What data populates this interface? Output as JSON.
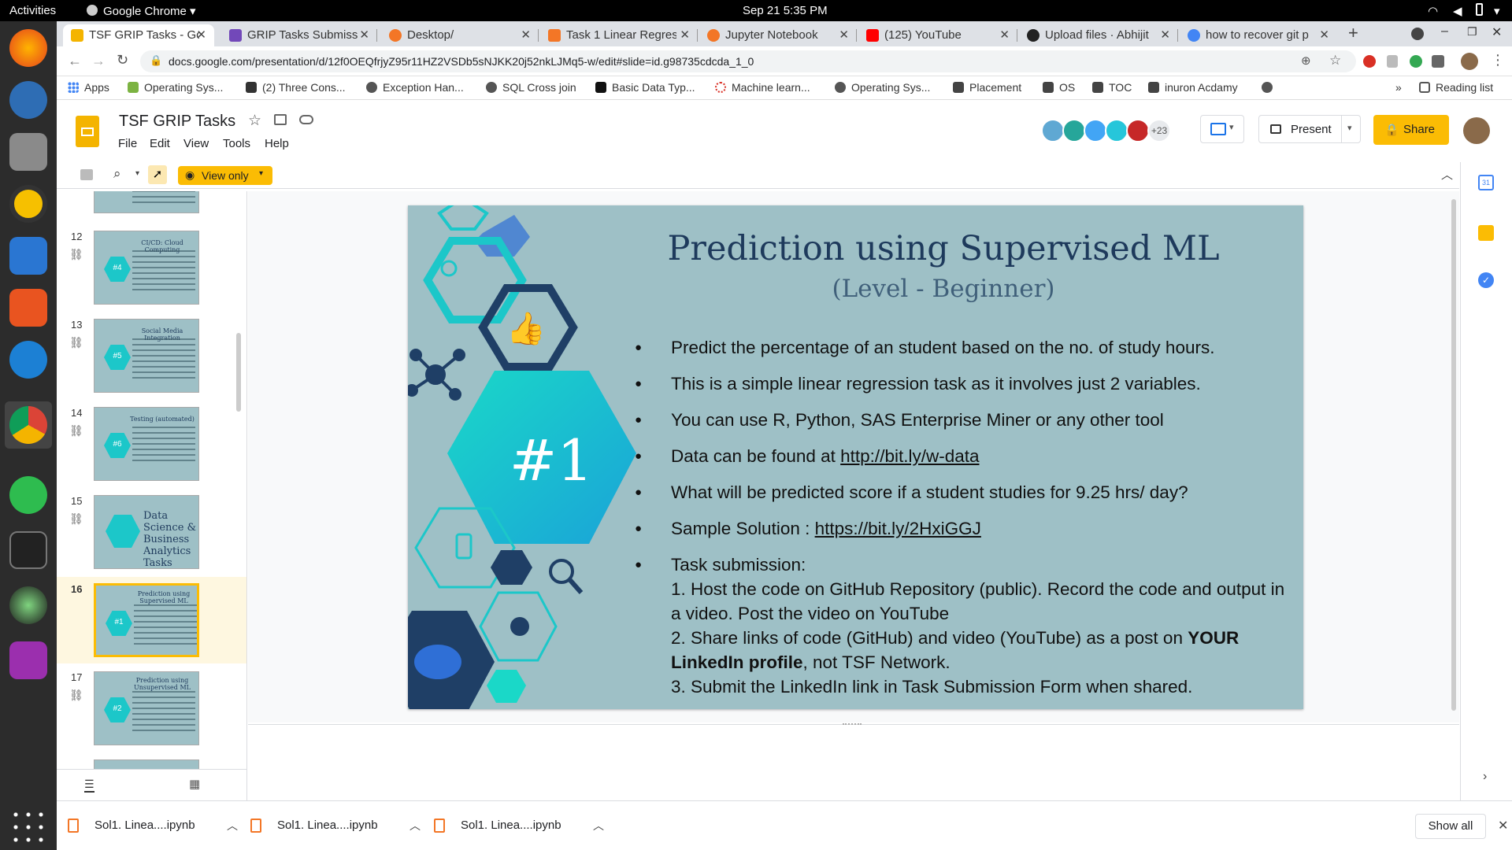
{
  "system": {
    "activities": "Activities",
    "app_menu": "Google Chrome",
    "clock": "Sep 21  5:35 PM"
  },
  "tabs": [
    {
      "label": "TSF GRIP Tasks - Goo",
      "color": "#f4b400"
    },
    {
      "label": "GRIP Tasks Submissi",
      "color": "#7248b9"
    },
    {
      "label": "Desktop/",
      "color": "#f37626"
    },
    {
      "label": "Task 1 Linear Regres",
      "color": "#f37626"
    },
    {
      "label": "Jupyter Notebook",
      "color": "#f37626"
    },
    {
      "label": "(125) YouTube",
      "color": "#ff0000"
    },
    {
      "label": "Upload files · Abhijit",
      "color": "#222222"
    },
    {
      "label": "how to recover git p",
      "color": "#4285f4"
    }
  ],
  "address": {
    "url": "docs.google.com/presentation/d/12f0OEQfrjyZ95r11HZ2VSDb5sNJKK20j52nkLJMq5-w/edit#slide=id.g98735cdcda_1_0"
  },
  "bookmarks": [
    {
      "label": "Apps"
    },
    {
      "label": "Operating Sys..."
    },
    {
      "label": "(2) Three Cons..."
    },
    {
      "label": "Exception Han..."
    },
    {
      "label": "SQL Cross join"
    },
    {
      "label": "Basic Data Typ..."
    },
    {
      "label": "Machine learn..."
    },
    {
      "label": "Operating Sys..."
    },
    {
      "label": "Placement"
    },
    {
      "label": "OS"
    },
    {
      "label": "TOC"
    },
    {
      "label": "inuron Acdamy"
    }
  ],
  "reading_list": "Reading list",
  "doc": {
    "title": "TSF GRIP  Tasks",
    "menu": [
      "File",
      "Edit",
      "View",
      "Tools",
      "Help"
    ],
    "collaborators_more": "+23",
    "present": "Present",
    "share": "Share",
    "view_only": "View only"
  },
  "slides": [
    {
      "num": "12",
      "title": "CI/CD: Cloud Computing",
      "badge": "#4"
    },
    {
      "num": "13",
      "title": "Social Media Integration",
      "badge": "#5"
    },
    {
      "num": "14",
      "title": "Testing (automated)",
      "badge": "#6"
    },
    {
      "num": "15",
      "title": "Data Science & Business Analytics Tasks",
      "badge": ""
    },
    {
      "num": "16",
      "title": "Prediction using Supervised ML",
      "badge": "#1"
    },
    {
      "num": "17",
      "title": "Prediction using Unsupervised ML",
      "badge": "#2"
    }
  ],
  "current_slide": {
    "title": "Prediction using Supervised ML",
    "subtitle": "(Level - Beginner)",
    "badge": "#1",
    "bullets": {
      "b1": "Predict the percentage of an student based on the no. of study hours.",
      "b2": "This is a simple linear  regression task as it involves just 2 variables.",
      "b3": "You can use R, Python, SAS Enterprise Miner or any other tool",
      "b4_pre": "Data can be found at ",
      "b4_link": "http://bit.ly/w-data",
      "b5": "What will be predicted score if a student studies for 9.25 hrs/ day?",
      "b6_pre": "Sample Solution : ",
      "b6_link": "https://bit.ly/2HxiGGJ",
      "b7_head": "Task submission:",
      "b7_1": "1. Host the code on GitHub Repository (public). Record the code and output in a video. Post the video on YouTube",
      "b7_2a": "2. Share links of code (GitHub) and video (YouTube) as a post on ",
      "b7_2b": "YOUR LinkedIn profile",
      "b7_2c": ", not TSF Network.",
      "b7_3": "3. Submit the LinkedIn link in Task Submission Form when shared."
    }
  },
  "downloads": [
    {
      "label": "Sol1. Linea....ipynb"
    },
    {
      "label": "Sol1. Linea....ipynb"
    },
    {
      "label": "Sol1. Linea....ipynb"
    }
  ],
  "show_all": "Show all",
  "colors": {
    "slide_bg": "#9ec0c6",
    "hex_cyan": "#1cc7c9",
    "hex_navy": "#1f3f66",
    "share_yellow": "#fbbc04"
  }
}
